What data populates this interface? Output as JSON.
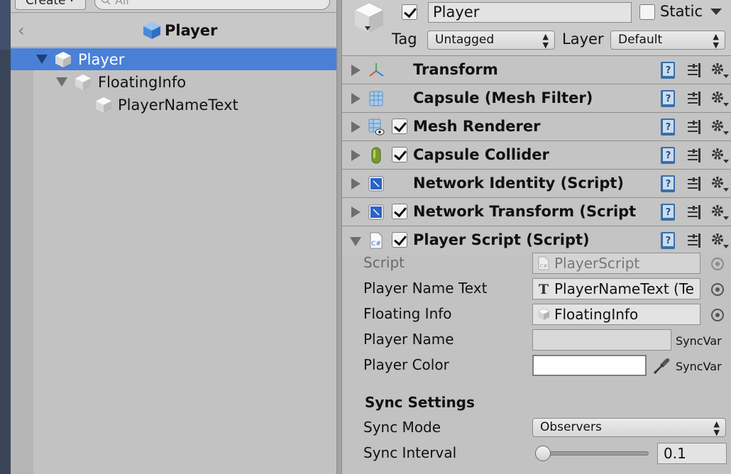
{
  "hierarchy": {
    "create_label": "Create",
    "search_placeholder": "All",
    "title": "Player",
    "tree": [
      {
        "label": "Player",
        "depth": 0,
        "expanded": true,
        "selected": true
      },
      {
        "label": "FloatingInfo",
        "depth": 1,
        "expanded": true,
        "selected": false
      },
      {
        "label": "PlayerNameText",
        "depth": 2,
        "expanded": false,
        "selected": false
      }
    ],
    "selection_color": "#4a80d6"
  },
  "inspector": {
    "object_name": "Player",
    "object_active": true,
    "static_label": "Static",
    "static_checked": false,
    "tag_label": "Tag",
    "tag_value": "Untagged",
    "layer_label": "Layer",
    "layer_value": "Default",
    "components": [
      {
        "label": "Transform",
        "icon": "transform-icon",
        "has_checkbox": false,
        "expanded": false
      },
      {
        "label": "Capsule (Mesh Filter)",
        "icon": "mesh-filter-icon",
        "has_checkbox": false,
        "expanded": false
      },
      {
        "label": "Mesh Renderer",
        "icon": "mesh-renderer-icon",
        "has_checkbox": true,
        "expanded": false
      },
      {
        "label": "Capsule Collider",
        "icon": "capsule-collider-icon",
        "has_checkbox": true,
        "expanded": false
      },
      {
        "label": "Network Identity (Script)",
        "icon": "network-identity-icon",
        "has_checkbox": false,
        "expanded": false
      },
      {
        "label": "Network Transform (Script",
        "icon": "network-transform-icon",
        "has_checkbox": true,
        "expanded": false
      },
      {
        "label": "Player Script (Script)",
        "icon": "csharp-script-icon",
        "has_checkbox": true,
        "expanded": true
      }
    ],
    "player_script": {
      "script_label": "Script",
      "script_value": "PlayerScript",
      "player_name_text_label": "Player Name Text",
      "player_name_text_value": "PlayerNameText (Te",
      "floating_info_label": "Floating Info",
      "floating_info_value": "FloatingInfo",
      "player_name_label": "Player Name",
      "player_name_value": "",
      "player_name_suffix": "SyncVar",
      "player_color_label": "Player Color",
      "player_color_value": "#ffffff",
      "player_color_suffix": "SyncVar",
      "sync_settings_heading": "Sync Settings",
      "sync_mode_label": "Sync Mode",
      "sync_mode_value": "Observers",
      "sync_interval_label": "Sync Interval",
      "sync_interval_value": "0.1"
    }
  }
}
